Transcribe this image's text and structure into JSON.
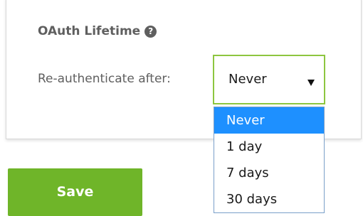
{
  "settings_card": {
    "section_title": "OAuth Lifetime",
    "help_icon": "question-circle-icon",
    "reauth_label": "Re-authenticate after:",
    "select": {
      "selected_value": "Never",
      "caret_icon": "caret-down-icon",
      "options": [
        "Never",
        "1 day",
        "7 days",
        "30 days"
      ],
      "highlighted_index": 0
    }
  },
  "actions": {
    "save_label": "Save"
  },
  "colors": {
    "accent_green": "#6fb529",
    "select_border": "#8dc63f",
    "highlight_blue": "#1e90ff",
    "label_gray": "#5f5f5f"
  }
}
